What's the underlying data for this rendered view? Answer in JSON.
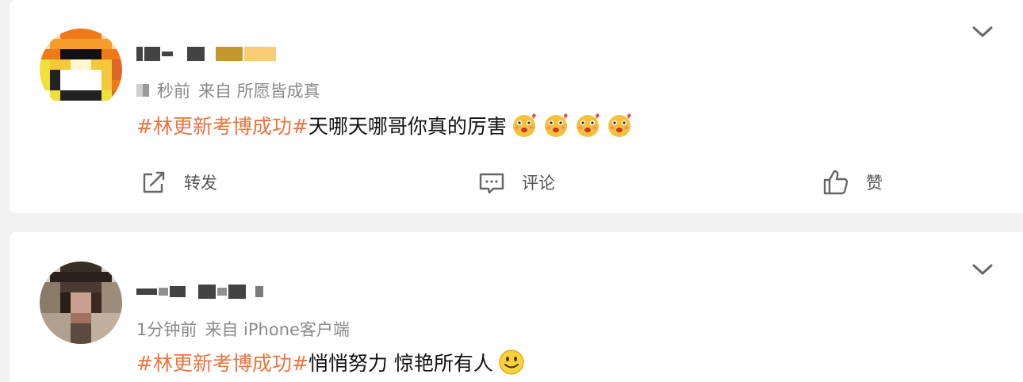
{
  "posts": [
    {
      "time": "秒前",
      "source": "来自 所愿皆成真",
      "hashtag": "#林更新考博成功#",
      "text": "天哪天哪哥你真的厉害",
      "emoji_icons": [
        "blushing-hug-emoji",
        "blushing-hug-emoji",
        "blushing-hug-emoji",
        "blushing-hug-emoji"
      ],
      "actions": {
        "repost_label": "转发",
        "comment_label": "评论",
        "like_label": "赞"
      }
    },
    {
      "time": "1分钟前",
      "source": "来自 iPhone客户端",
      "hashtag": "#林更新考博成功#",
      "text": "悄悄努力 惊艳所有人",
      "emoji_icons": [
        "smile-emoji"
      ]
    }
  ],
  "colors": {
    "hashtag": "#eb7340",
    "meta_text": "#8a8a8a",
    "body_text": "#111111",
    "background": "#f2f2f2"
  },
  "icons": [
    "chevron-down-icon",
    "repost-icon",
    "comment-icon",
    "like-icon"
  ]
}
